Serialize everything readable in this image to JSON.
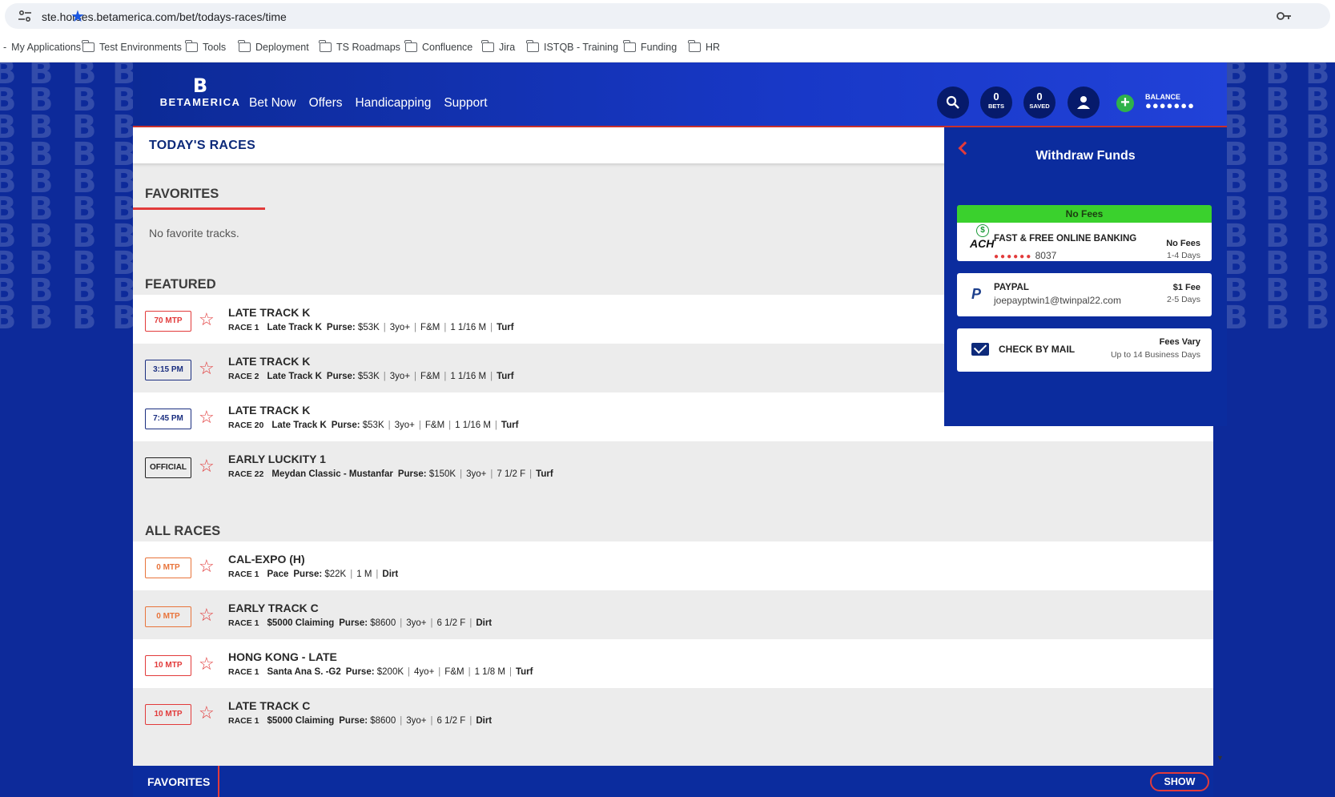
{
  "browser": {
    "url": "ste.horses.betamerica.com/bet/todays-races/time",
    "bookmarks": [
      "My Applications",
      "Test Environments",
      "Tools",
      "Deployment",
      "TS Roadmaps",
      "Confluence",
      "Jira",
      "ISTQB - Training",
      "Funding",
      "HR"
    ]
  },
  "header": {
    "logo_mark": "B",
    "logo_text": "BETAMERICA",
    "nav": [
      "Bet Now",
      "Offers",
      "Handicapping",
      "Support"
    ],
    "bets_count": "0",
    "bets_label": "BETS",
    "saved_count": "0",
    "saved_label": "SAVED",
    "balance_label": "BALANCE",
    "balance_value": "●●●●●●●"
  },
  "page": {
    "title": "TODAY'S RACES",
    "favorites_title": "FAVORITES",
    "no_favorites": "No favorite tracks.",
    "featured_title": "FEATURED",
    "all_races_title": "ALL RACES"
  },
  "featured": [
    {
      "status": "70 MTP",
      "track": "LATE TRACK K",
      "race": "RACE 1",
      "name": "Late Track K",
      "purse": "$53K",
      "details": [
        "3yo+",
        "F&M",
        "1 1/16 M"
      ],
      "surface": "Turf"
    },
    {
      "status": "3:15 PM",
      "track": "LATE TRACK K",
      "race": "RACE 2",
      "name": "Late Track K",
      "purse": "$53K",
      "details": [
        "3yo+",
        "F&M",
        "1 1/16 M"
      ],
      "surface": "Turf"
    },
    {
      "status": "7:45 PM",
      "track": "LATE TRACK K",
      "race": "RACE 20",
      "name": "Late Track K",
      "purse": "$53K",
      "details": [
        "3yo+",
        "F&M",
        "1 1/16 M"
      ],
      "surface": "Turf"
    },
    {
      "status": "OFFICIAL",
      "track": "EARLY LUCKITY 1",
      "race": "RACE 22",
      "name": "Meydan Classic - Mustanfar",
      "purse": "$150K",
      "details": [
        "3yo+",
        "7 1/2 F"
      ],
      "surface": "Turf"
    }
  ],
  "all_races": [
    {
      "status": "0 MTP",
      "track": "CAL-EXPO (H)",
      "race": "RACE 1",
      "name": "Pace",
      "purse": "$22K",
      "details": [
        "1 M"
      ],
      "surface": "Dirt"
    },
    {
      "status": "0 MTP",
      "track": "EARLY TRACK C",
      "race": "RACE 1",
      "name": "$5000 Claiming",
      "purse": "$8600",
      "details": [
        "3yo+",
        "6 1/2 F"
      ],
      "surface": "Dirt"
    },
    {
      "status": "10 MTP",
      "track": "HONG KONG - LATE",
      "race": "RACE 1",
      "name": "Santa Ana S. -G2",
      "purse": "$200K",
      "details": [
        "4yo+",
        "F&M",
        "1 1/8 M"
      ],
      "surface": "Turf"
    },
    {
      "status": "10 MTP",
      "track": "LATE TRACK C",
      "race": "RACE 1",
      "name": "$5000 Claiming",
      "purse": "$8600",
      "details": [
        "3yo+",
        "6 1/2 F"
      ],
      "surface": "Dirt"
    }
  ],
  "purse_label": "Purse:",
  "withdraw": {
    "title": "Withdraw Funds",
    "no_fees_banner": "No Fees",
    "ach": {
      "title": "FAST & FREE ONLINE BANKING",
      "masked": "●●●●●●",
      "last4": "8037",
      "fee": "No Fees",
      "days": "1-4 Days",
      "icon_text": "ACH"
    },
    "paypal": {
      "title": "PAYPAL",
      "email": "joepayptwin1@twinpal22.com",
      "fee": "$1 Fee",
      "days": "2-5 Days",
      "icon_text": "P"
    },
    "mail": {
      "title": "CHECK BY MAIL",
      "fee": "Fees Vary",
      "days": "Up to 14 Business Days"
    }
  },
  "bottom_bar": {
    "favorites": "FAVORITES",
    "show": "SHOW"
  },
  "colors": {
    "brand_blue": "#0d2a9a",
    "accent_red": "#e23b3b",
    "green": "#3ad12d"
  }
}
